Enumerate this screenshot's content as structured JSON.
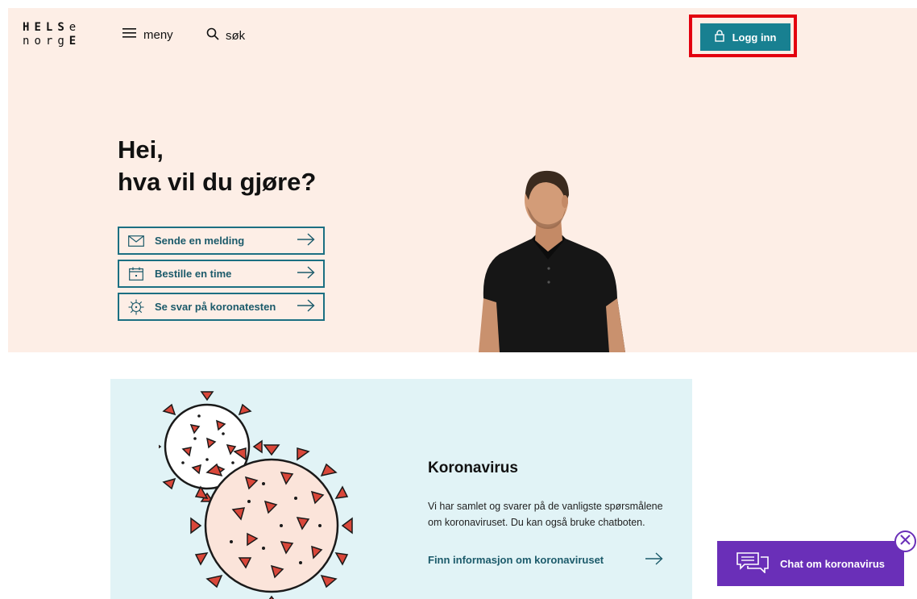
{
  "header": {
    "logo_line1": "HELSe",
    "logo_line2": "norgE",
    "menu_label": "meny",
    "search_label": "søk",
    "login_label": "Logg inn",
    "icons": {
      "menu": "hamburger-icon",
      "search": "search-icon",
      "login": "lock-icon"
    }
  },
  "hero": {
    "title_line1": "Hei,",
    "title_line2": "hva vil du gjøre?",
    "actions": [
      {
        "label": "Sende en melding",
        "icon": "envelope-icon"
      },
      {
        "label": "Bestille en time",
        "icon": "calendar-icon"
      },
      {
        "label": "Se svar på koronatesten",
        "icon": "virus-icon"
      }
    ],
    "image": "man-in-black-polo-shirt"
  },
  "covid": {
    "title": "Koronavirus",
    "text": "Vi har samlet og svarer på de vanligste spørsmålene om koronaviruset. Du kan også bruke chatboten.",
    "link_label": "Finn informasjon om koronaviruset"
  },
  "chat": {
    "label": "Chat om koronavirus",
    "icon": "chat-bubbles-icon",
    "close_icon": "close-icon"
  },
  "colors": {
    "hero_bg": "#fdeee6",
    "login_bg": "#188091",
    "highlight": "#e3000f",
    "action_border": "#1b6f82",
    "card_bg": "#e1f3f6",
    "chat_bg": "#6a2fb8",
    "virus_red": "#d9473a"
  }
}
